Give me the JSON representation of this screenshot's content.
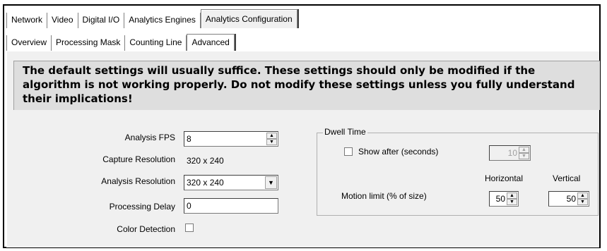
{
  "tabs_top": [
    "Network",
    "Video",
    "Digital I/O",
    "Analytics Engines",
    "Analytics Configuration"
  ],
  "tabs_sub": [
    "Overview",
    "Processing Mask",
    "Counting Line",
    "Advanced"
  ],
  "notice": "The default settings will usually suffice. These settings should only be modified if the algorithm is not working properly. Do not modify these settings unless you fully understand their implications!",
  "form": {
    "analysis_fps_label": "Analysis FPS",
    "analysis_fps_value": "8",
    "capture_resolution_label": "Capture Resolution",
    "capture_resolution_value": "320 x 240",
    "analysis_resolution_label": "Analysis Resolution",
    "analysis_resolution_value": "320 x 240",
    "processing_delay_label": "Processing Delay",
    "processing_delay_value": "0",
    "color_detection_label": "Color Detection",
    "color_detection_checked": false
  },
  "dwell": {
    "title": "Dwell Time",
    "show_after_label": "Show after (seconds)",
    "show_after_checked": false,
    "show_after_value": "10",
    "horizontal_label": "Horizontal",
    "vertical_label": "Vertical",
    "motion_limit_label": "Motion limit (% of size)",
    "horizontal_value": "50",
    "vertical_value": "50"
  }
}
